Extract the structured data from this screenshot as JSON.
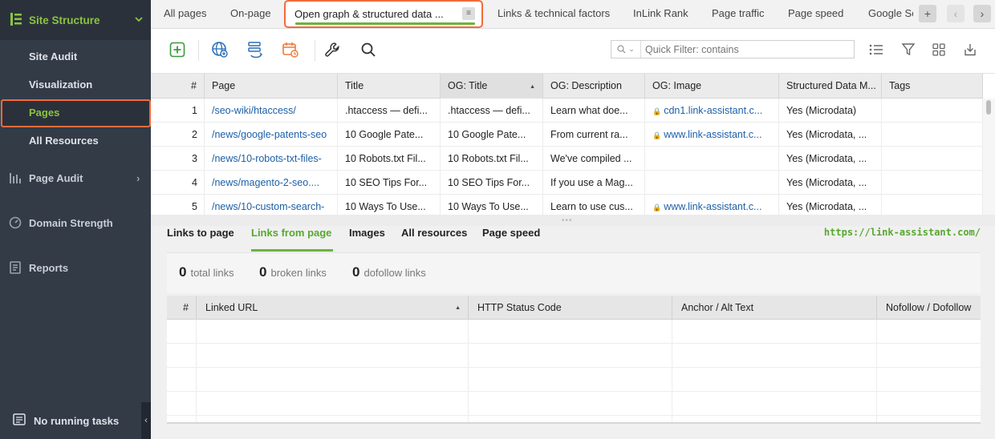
{
  "sidebar": {
    "project": "Site Structure",
    "items": [
      {
        "label": "Site Audit"
      },
      {
        "label": "Visualization"
      },
      {
        "label": "Pages"
      },
      {
        "label": "All Resources"
      }
    ],
    "sections": [
      {
        "label": "Page Audit"
      },
      {
        "label": "Domain Strength"
      },
      {
        "label": "Reports"
      }
    ],
    "status": "No running tasks"
  },
  "tabs": {
    "items": [
      "All pages",
      "On-page",
      "Open graph & structured data ...",
      "Links & technical factors",
      "InLink Rank",
      "Page traffic",
      "Page speed",
      "Google Se"
    ],
    "active": "Open graph & structured data ..."
  },
  "toolbar": {
    "quick_filter_placeholder": "Quick Filter: contains"
  },
  "grid": {
    "columns": [
      "#",
      "Page",
      "Title",
      "OG: Title",
      "OG: Description",
      "OG: Image",
      "Structured Data M...",
      "Tags"
    ],
    "sorted_column": "OG: Title",
    "rows": [
      {
        "n": "1",
        "page": "/seo-wiki/htaccess/",
        "title": ".htaccess — defi...",
        "og_title": ".htaccess — defi...",
        "og_desc": "Learn what doe...",
        "og_image": "cdn1.link-assistant.c...",
        "sd": "Yes (Microdata)",
        "tags": ""
      },
      {
        "n": "2",
        "page": "/news/google-patents-seo",
        "title": "10 Google Pate...",
        "og_title": "10 Google Pate...",
        "og_desc": "From current ra...",
        "og_image": "www.link-assistant.c...",
        "sd": "Yes (Microdata, ...",
        "tags": ""
      },
      {
        "n": "3",
        "page": "/news/10-robots-txt-files-",
        "title": "10 Robots.txt Fil...",
        "og_title": "10 Robots.txt Fil...",
        "og_desc": "We've compiled ...",
        "og_image": "",
        "sd": "Yes (Microdata, ...",
        "tags": ""
      },
      {
        "n": "4",
        "page": "/news/magento-2-seo....",
        "title": "10 SEO Tips For...",
        "og_title": "10 SEO Tips For...",
        "og_desc": "If you use a Mag...",
        "og_image": "",
        "sd": "Yes (Microdata, ...",
        "tags": ""
      },
      {
        "n": "5",
        "page": "/news/10-custom-search-",
        "title": "10 Ways To Use...",
        "og_title": "10 Ways To Use...",
        "og_desc": "Learn to use cus...",
        "og_image": "www.link-assistant.c...",
        "sd": "Yes (Microdata, ...",
        "tags": ""
      }
    ]
  },
  "lower": {
    "tabs": [
      "Links to page",
      "Links from page",
      "Images",
      "All resources",
      "Page speed"
    ],
    "active_tab": "Links from page",
    "url": "https://link-assistant.com/",
    "stats": [
      {
        "value": "0",
        "label": "total links"
      },
      {
        "value": "0",
        "label": "broken links"
      },
      {
        "value": "0",
        "label": "dofollow links"
      }
    ],
    "columns": [
      "#",
      "Linked URL",
      "HTTP Status Code",
      "Anchor / Alt Text",
      "Nofollow / Dofollow"
    ],
    "sorted_column": "Linked URL"
  },
  "colors": {
    "accent_green": "#6cb33f",
    "highlight_orange": "#f26b3a",
    "sidebar_bg": "#333b47",
    "link_blue": "#1c5fa8"
  }
}
